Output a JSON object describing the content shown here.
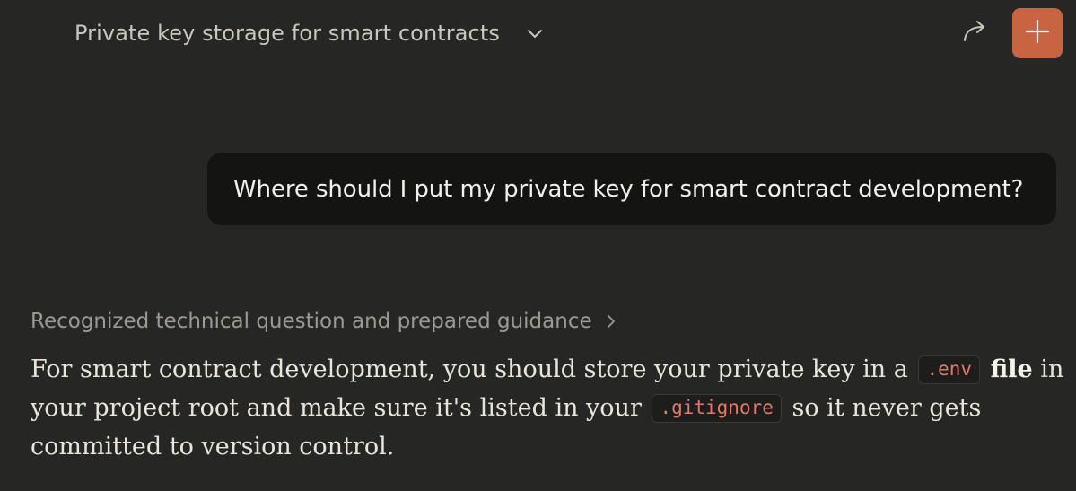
{
  "header": {
    "title": "Private key storage for smart contracts"
  },
  "icons": {
    "title_dropdown": "chevron-down-icon",
    "share": "share-arrow-icon",
    "new_chat": "plus-icon",
    "thinking_expand": "chevron-right-icon"
  },
  "colors": {
    "background": "#262624",
    "accent": "#c96442",
    "user_bubble": "#141413",
    "inline_code_text": "#e2786a"
  },
  "conversation": {
    "user_message": "Where should I put my private key for smart contract development?",
    "thinking_summary": "Recognized technical question and prepared guidance",
    "response": {
      "line1_part1": "For smart contract development, you should store your private key in a",
      "code1": ".env",
      "bold1": "file",
      "line1_part2": "in",
      "line2_part1": "your project root and make sure it's listed in your",
      "code2": ".gitignore",
      "line2_part2": "so it never gets",
      "line3": "committed to version control."
    }
  }
}
